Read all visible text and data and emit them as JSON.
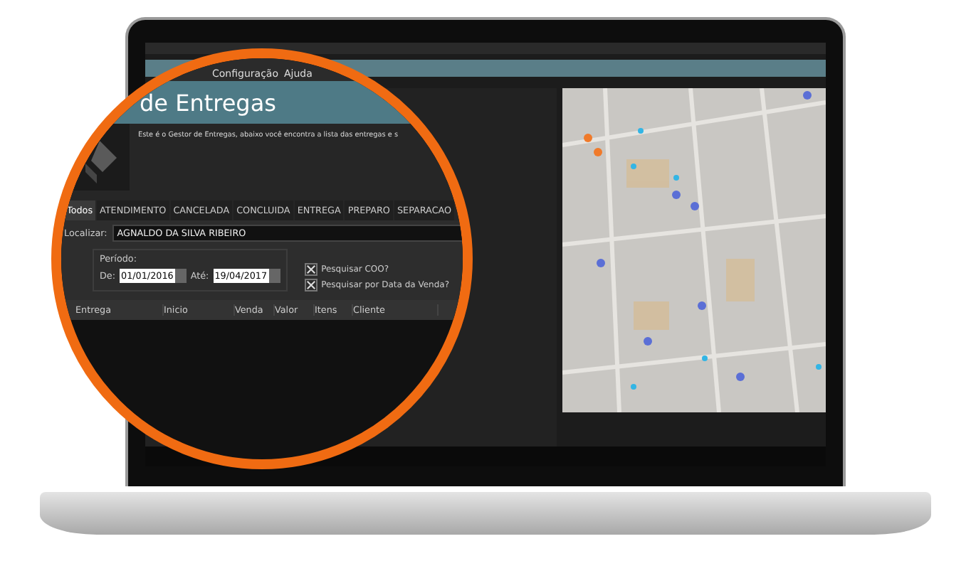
{
  "menu": [
    "Configuração",
    "Ajuda"
  ],
  "header": {
    "title": "de Entregas",
    "description": "Este é o Gestor de Entregas, abaixo você encontra a lista das entregas e s"
  },
  "tabs": [
    {
      "label": "Todos",
      "selected": true
    },
    {
      "label": "ATENDIMENTO",
      "selected": false
    },
    {
      "label": "CANCELADA",
      "selected": false
    },
    {
      "label": "CONCLUIDA",
      "selected": false
    },
    {
      "label": "ENTREGA",
      "selected": false
    },
    {
      "label": "PREPARO",
      "selected": false
    },
    {
      "label": "SEPARACAO",
      "selected": false
    }
  ],
  "search": {
    "label": "Localizar:",
    "value": "AGNALDO DA SILVA RIBEIRO"
  },
  "period": {
    "label": "Período:",
    "from_label": "De:",
    "from_value": "01/01/2016",
    "to_label": "Até:",
    "to_value": "19/04/2017"
  },
  "options": [
    {
      "label": "Pesquisar COO?",
      "checked": true
    },
    {
      "label": "Pesquisar por Data da Venda?",
      "checked": true
    }
  ],
  "table": {
    "columns": [
      "Entrega",
      "Inicio",
      "Venda",
      "Valor",
      "Itens",
      "Cliente"
    ]
  }
}
